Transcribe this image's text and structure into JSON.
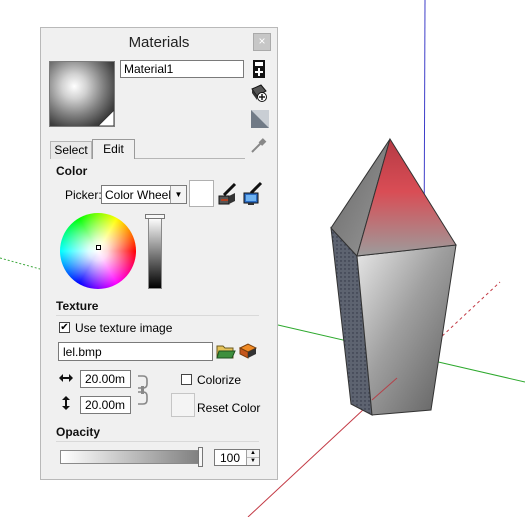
{
  "materials_panel": {
    "title": "Materials",
    "close_glyph": "×",
    "material_name": "Material1",
    "tabs": [
      {
        "label": "Select",
        "active": false
      },
      {
        "label": "Edit",
        "active": true
      }
    ],
    "color": {
      "section_title": "Color",
      "picker_label": "Picker:",
      "picker_value": "Color Wheel"
    },
    "texture": {
      "section_title": "Texture",
      "use_texture_label": "Use texture image",
      "use_texture_checked": true,
      "file_name": "lel.bmp",
      "width_value": "20.00m",
      "height_value": "20.00m",
      "colorize_label": "Colorize",
      "colorize_checked": false,
      "reset_color_label": "Reset Color"
    },
    "opacity": {
      "section_title": "Opacity",
      "value": "100",
      "level": 1.0
    },
    "colors": {
      "panel_bg": "#f0f0f0",
      "material_top": "#d64b52",
      "material_body": "#808080"
    },
    "icons": [
      "create-material-icon",
      "paint-bucket-icon",
      "default-material-icon",
      "eyedropper-icon",
      "sample-paint-icon",
      "match-screen-color-icon",
      "browse-folder-icon",
      "edit-texture-icon",
      "link-lock-icon",
      "width-arrows-icon",
      "height-arrows-icon"
    ]
  }
}
